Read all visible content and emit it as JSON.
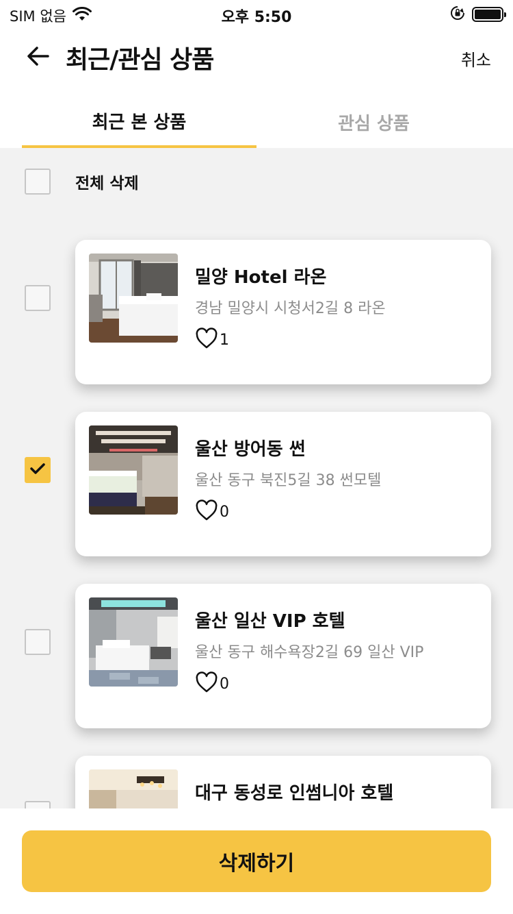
{
  "status_bar": {
    "carrier": "SIM 없음",
    "time": "오후 5:50",
    "icons": [
      "wifi-icon",
      "orientation-lock-icon",
      "battery-icon"
    ]
  },
  "header": {
    "back_icon": "arrow-left-icon",
    "title": "최근/관심 상품",
    "cancel_label": "취소"
  },
  "tabs": [
    {
      "label": "최근 본 상품",
      "active": true
    },
    {
      "label": "관심 상품",
      "active": false
    }
  ],
  "select_all": {
    "label": "전체 삭제",
    "checked": false
  },
  "items": [
    {
      "name": "밀양 Hotel 라온",
      "address": "경남 밀양시 시청서2길 8 라온",
      "likes": "1",
      "checked": false
    },
    {
      "name": "울산 방어동 썬",
      "address": "울산 동구 북진5길 38 썬모텔",
      "likes": "0",
      "checked": true
    },
    {
      "name": "울산 일산 VIP 호텔",
      "address": "울산 동구 해수욕장2길 69 일산 VIP",
      "likes": "0",
      "checked": false
    },
    {
      "name": "대구 동성로 인썸니아 호텔",
      "address": "",
      "likes": "",
      "checked": false
    }
  ],
  "bottom_button": {
    "label": "삭제하기"
  },
  "colors": {
    "accent": "#F6C443",
    "background": "#f2f2f2",
    "muted_text": "#8c8c8c",
    "inactive_tab": "#a8a8a8"
  }
}
